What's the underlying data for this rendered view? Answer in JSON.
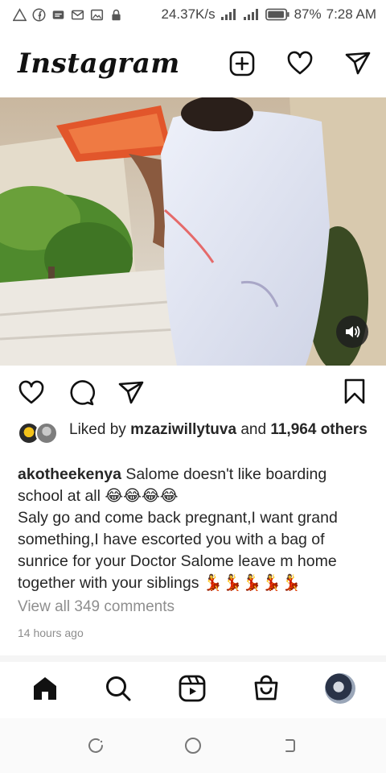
{
  "status_bar": {
    "net_speed": "24.37K/s",
    "battery": "87%",
    "time": "7:28 AM",
    "icons": [
      "alert-triangle-icon",
      "facebook-icon",
      "message-icon",
      "gmail-icon",
      "gallery-icon",
      "lock-icon",
      "signal-icon",
      "signal-icon",
      "battery-icon"
    ]
  },
  "header": {
    "logo": "Instagram",
    "icons": [
      "new-post-icon",
      "heart-icon",
      "direct-message-icon"
    ]
  },
  "post": {
    "media": {
      "type": "video",
      "sound_icon": "speaker-icon"
    },
    "actions": [
      "like-icon",
      "comment-icon",
      "share-icon",
      "save-icon"
    ],
    "likes": {
      "prefix": "Liked by",
      "user": "mzaziwillytuva",
      "and": "and",
      "count": "11,964",
      "suffix": "others"
    },
    "caption": {
      "username": "akotheekenya",
      "text": "Salome doesn't like boarding school at all 😂😂😂😂\nSaly go and come back pregnant,I want grand something,I have escorted you with a bag of sunrice for your Doctor Salome leave m home together with your siblings 💃💃💃💃💃"
    },
    "view_comments": "View all 349 comments",
    "time_ago": "14 hours ago"
  },
  "bottom_nav": {
    "items": [
      "home-icon",
      "search-icon",
      "reels-icon",
      "shop-icon",
      "profile-avatar"
    ]
  },
  "system_nav": {
    "items": [
      "recent-apps-icon",
      "home-circle-icon",
      "back-icon"
    ]
  },
  "colors": {
    "text": "#262626",
    "muted": "#8e8e8e",
    "background": "#ffffff"
  }
}
